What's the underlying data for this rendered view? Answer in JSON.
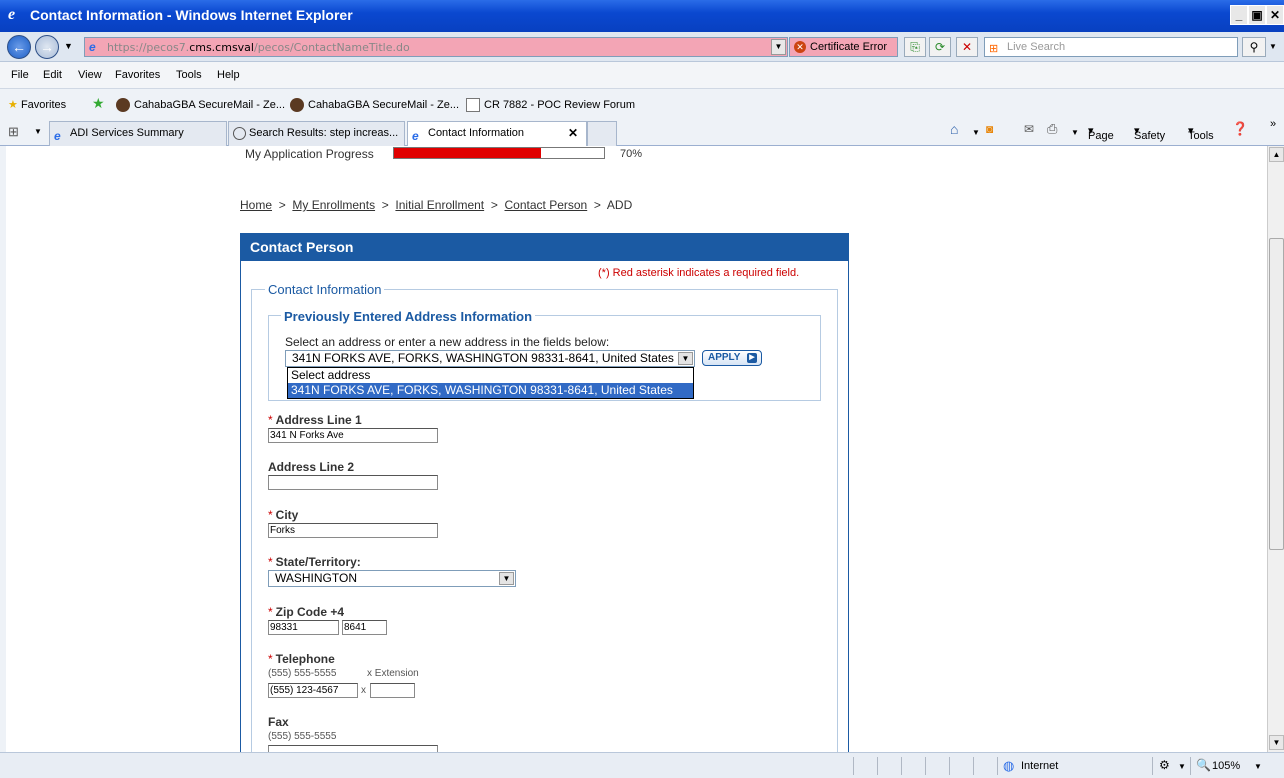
{
  "window": {
    "title": "Contact Information - Windows Internet Explorer",
    "min": "_",
    "max": "▣",
    "close": "✕"
  },
  "address_bar": {
    "url_prefix": "https://pecos7.",
    "url_host": "cms.cmsval",
    "url_path": "/pecos/ContactNameTitle.do",
    "cert_error": "Certificate Error",
    "search_placeholder": "Live Search"
  },
  "menu": [
    "File",
    "Edit",
    "View",
    "Favorites",
    "Tools",
    "Help"
  ],
  "favorites_bar": {
    "label": "Favorites",
    "links": [
      "CahabaGBA SecureMail - Ze...",
      "CahabaGBA SecureMail - Ze...",
      "CR 7882 - POC Review Forum"
    ]
  },
  "tabs": [
    {
      "label": "ADI Services Summary"
    },
    {
      "label": "Search Results: step increas..."
    },
    {
      "label": "Contact Information"
    }
  ],
  "command_bar": {
    "page": "Page",
    "safety": "Safety",
    "tools": "Tools"
  },
  "progress": {
    "label": "My Application Progress",
    "value": 0.7,
    "text": "70%"
  },
  "breadcrumb": {
    "items": [
      "Home",
      "My Enrollments",
      "Initial Enrollment",
      "Contact Person"
    ],
    "current": "ADD",
    "sep": ">"
  },
  "panel": {
    "title": "Contact Person",
    "required_note": "(*) Red asterisk indicates a required field.",
    "section_title": "Contact Information",
    "prev_address": {
      "title": "Previously Entered Address Information",
      "instruction": "Select an address or enter a new address in the fields below:",
      "selected": "341N FORKS AVE, FORKS, WASHINGTON 98331-8641, United States",
      "options": [
        "Select address",
        "341N FORKS AVE, FORKS, WASHINGTON 98331-8641, United States"
      ],
      "apply": "APPLY"
    },
    "fields": {
      "address1": {
        "label": "Address Line 1",
        "value": "341 N Forks Ave"
      },
      "address2": {
        "label": "Address Line 2",
        "value": ""
      },
      "city": {
        "label": "City",
        "value": "Forks"
      },
      "state": {
        "label": "State/Territory:",
        "value": "WASHINGTON"
      },
      "zip": {
        "label": "Zip Code +4",
        "value": "98331",
        "plus4": "8641"
      },
      "telephone": {
        "label": "Telephone",
        "hint": "(555) 555-5555",
        "ext_hint": "x  Extension",
        "value": "(555) 123-4567",
        "x": "x",
        "ext": ""
      },
      "fax": {
        "label": "Fax",
        "hint": "(555) 555-5555"
      }
    },
    "asterisk": "*"
  },
  "status_bar": {
    "zone": "Internet",
    "zoom": "105%"
  }
}
